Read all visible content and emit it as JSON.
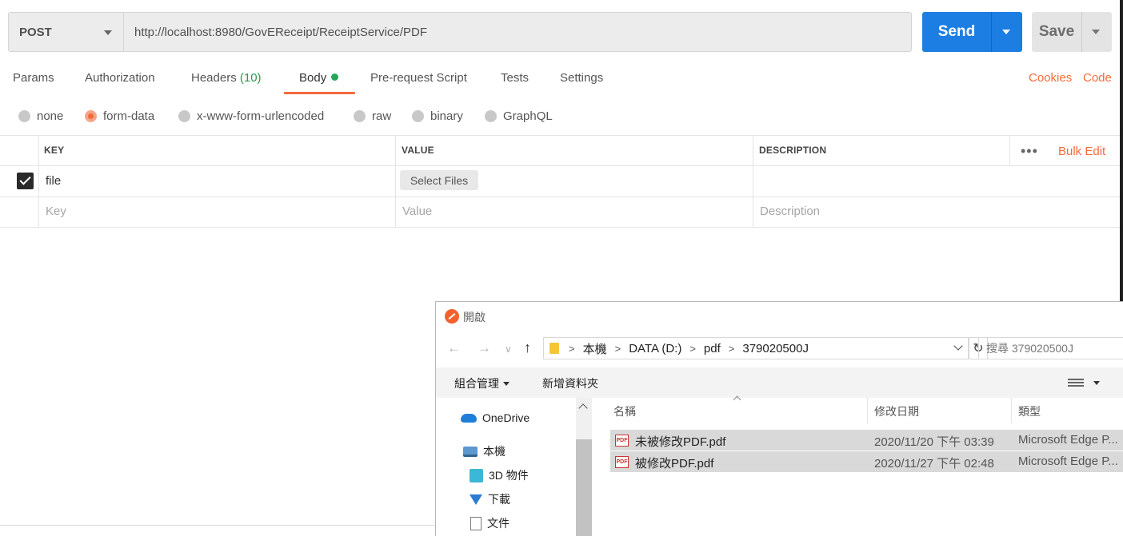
{
  "request": {
    "method": "POST",
    "url": "http://localhost:8980/GovEReceipt/ReceiptService/PDF",
    "send_label": "Send",
    "save_label": "Save"
  },
  "tabs": {
    "params": "Params",
    "authorization": "Authorization",
    "headers": "Headers",
    "headers_count": "(10)",
    "body": "Body",
    "prerequest": "Pre-request Script",
    "tests": "Tests",
    "settings": "Settings",
    "cookies": "Cookies",
    "code": "Code"
  },
  "body_types": {
    "none": "none",
    "form_data": "form-data",
    "urlencoded": "x-www-form-urlencoded",
    "raw": "raw",
    "binary": "binary",
    "graphql": "GraphQL",
    "selected": "form-data"
  },
  "table": {
    "headers": {
      "key": "KEY",
      "value": "VALUE",
      "description": "DESCRIPTION"
    },
    "bulk_edit": "Bulk Edit",
    "rows": [
      {
        "key": "file",
        "value_button": "Select Files",
        "checked": true
      }
    ],
    "placeholders": {
      "key": "Key",
      "value": "Value",
      "description": "Description"
    }
  },
  "dialog": {
    "title": "開啟",
    "breadcrumb": [
      "本機",
      "DATA (D:)",
      "pdf",
      "379020500J"
    ],
    "search_placeholder": "搜尋 379020500J",
    "toolbar": {
      "organize": "組合管理",
      "new_folder": "新增資料夾"
    },
    "nav_items": [
      "OneDrive",
      "本機",
      "3D 物件",
      "下載",
      "文件"
    ],
    "columns": {
      "name": "名稱",
      "date": "修改日期",
      "type": "類型"
    },
    "files": [
      {
        "name": "未被修改PDF.pdf",
        "date": "2020/11/20 下午 03:39",
        "type": "Microsoft Edge P..."
      },
      {
        "name": "被修改PDF.pdf",
        "date": "2020/11/27 下午 02:48",
        "type": "Microsoft Edge P..."
      }
    ]
  },
  "colors": {
    "accent": "#f26b3a",
    "send": "#1c7ee2",
    "success": "#26a65b"
  }
}
